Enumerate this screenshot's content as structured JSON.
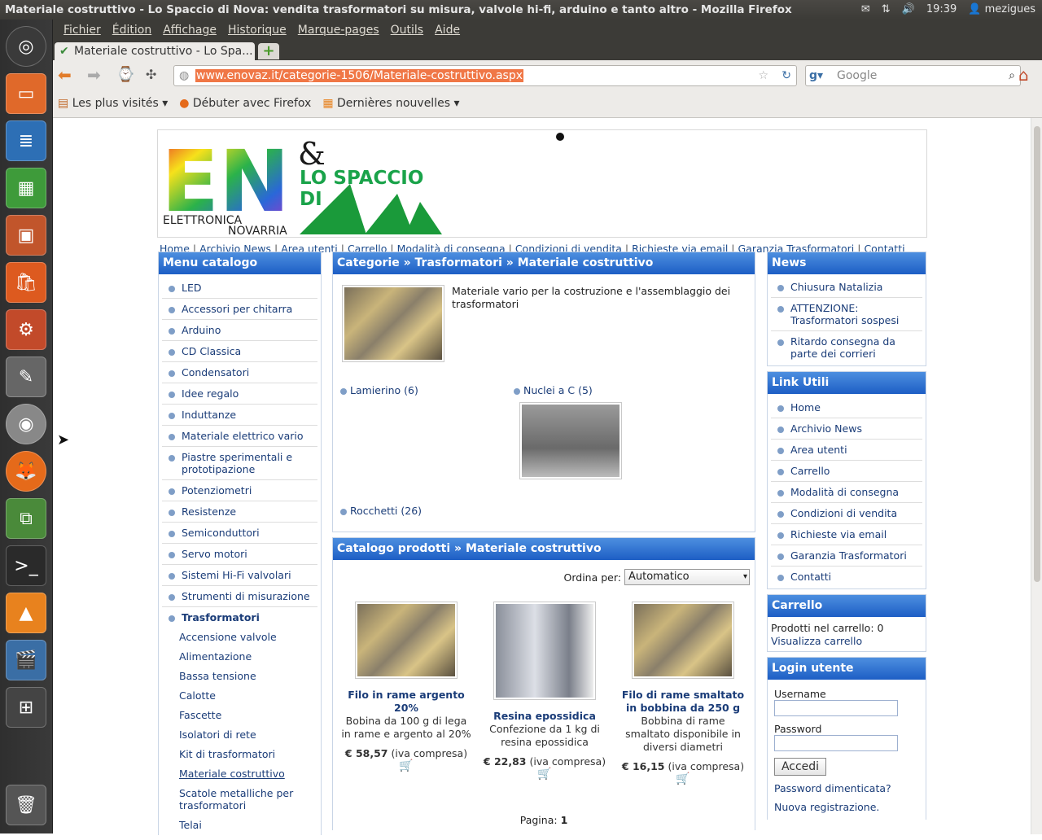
{
  "os": {
    "window_title": "Materiale costruttivo - Lo Spaccio di Nova: vendita trasformatori su misura, valvole hi-fi, arduino e tanto altro - Mozilla Firefox",
    "clock": "19:39",
    "user": "mezigues"
  },
  "browser": {
    "menu": [
      "Fichier",
      "Édition",
      "Affichage",
      "Historique",
      "Marque-pages",
      "Outils",
      "Aide"
    ],
    "tab_title": "Materiale costruttivo - Lo Spa...",
    "url": "www.enovaz.it/categorie-1506/Materiale-costruttivo.aspx",
    "search_placeholder": "Google",
    "bookmarks": [
      "Les plus visités ▾",
      "Débuter avec Firefox",
      "Dernières nouvelles ▾"
    ]
  },
  "logo": {
    "en": "EN",
    "amp": "&",
    "line1": "LO SPACCIO",
    "line2": "DI",
    "nova": "NOVA",
    "sub1": "ELETTRONICA",
    "sub2": "NOVARRIA"
  },
  "topnav": [
    "Home",
    "Archivio News",
    "Area utenti",
    "Carrello",
    "Modalità di consegna",
    "Condizioni di vendita",
    "Richieste via email",
    "Garanzia Trasformatori",
    "Contatti"
  ],
  "menu_catalogo": {
    "title": "Menu catalogo",
    "items": [
      "LED",
      "Accessori per chitarra",
      "Arduino",
      "CD Classica",
      "Condensatori",
      "Idee regalo",
      "Induttanze",
      "Materiale elettrico vario",
      "Piastre sperimentali e prototipazione",
      "Potenziometri",
      "Resistenze",
      "Semiconduttori",
      "Servo motori",
      "Sistemi Hi-Fi valvolari",
      "Strumenti di misurazione",
      "Trasformatori"
    ],
    "subitems": [
      "Accensione valvole",
      "Alimentazione",
      "Bassa tensione",
      "Calotte",
      "Fascette",
      "Isolatori di rete",
      "Kit di trasformatori",
      "Materiale costruttivo",
      "Scatole metalliche per trasformatori",
      "Telai"
    ]
  },
  "categorie": {
    "title": "Categorie » Trasformatori » Materiale costruttivo",
    "description": "Materiale vario per la costruzione e l'assemblaggio dei trasformatori",
    "sub1": "Lamierino (6)",
    "sub2": "Nuclei a C (5)",
    "sub3": "Rocchetti (26)"
  },
  "catalogo": {
    "title": "Catalogo prodotti » Materiale costruttivo",
    "sort_label": "Ordina per:",
    "sort_value": "Automatico",
    "products": [
      {
        "name": "Filo in rame argento 20%",
        "desc": "Bobina da 100 g di lega in rame e argento al 20%",
        "price": "€ 58,57",
        "vat": "(iva compresa)"
      },
      {
        "name": "Resina epossidica",
        "desc": "Confezione da 1 kg di resina epossidica",
        "price": "€ 22,83",
        "vat": "(iva compresa)"
      },
      {
        "name": "Filo di rame smaltato in bobbina da 250 g",
        "desc": "Bobbina di rame smaltato disponibile in diversi diametri",
        "price": "€ 16,15",
        "vat": "(iva compresa)"
      }
    ],
    "page_label": "Pagina:",
    "page_num": "1"
  },
  "news": {
    "title": "News",
    "items": [
      "Chiusura Natalizia",
      "ATTENZIONE: Trasformatori sospesi",
      "Ritardo consegna da parte dei corrieri"
    ]
  },
  "link_utili": {
    "title": "Link Utili",
    "items": [
      "Home",
      "Archivio News",
      "Area utenti",
      "Carrello",
      "Modalità di consegna",
      "Condizioni di vendita",
      "Richieste via email",
      "Garanzia Trasformatori",
      "Contatti"
    ]
  },
  "carrello": {
    "title": "Carrello",
    "count_text": "Prodotti nel carrello: 0",
    "view_link": "Visualizza carrello"
  },
  "login": {
    "title": "Login utente",
    "user_label": "Username",
    "pass_label": "Password",
    "button": "Accedi",
    "forgot": "Password dimenticata?",
    "register": "Nuova registrazione."
  }
}
